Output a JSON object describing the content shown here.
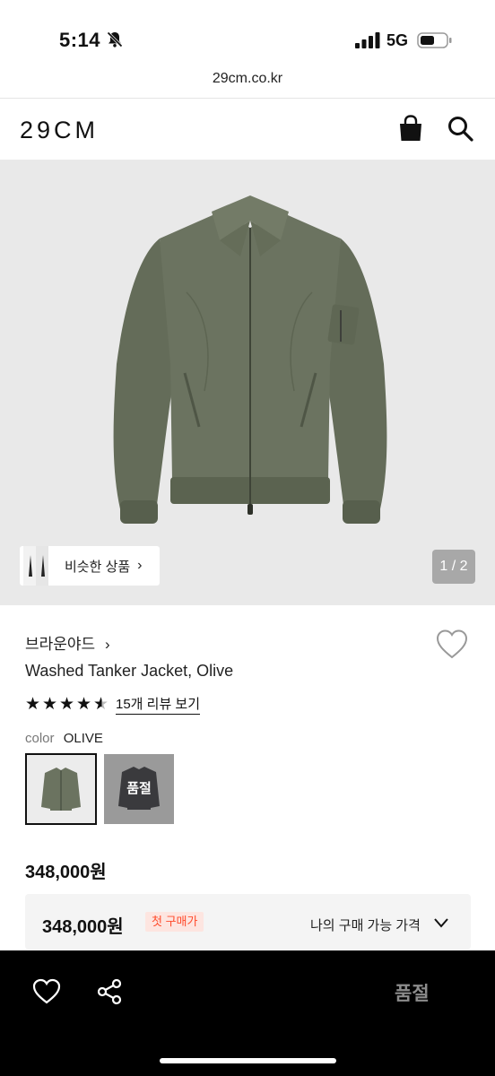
{
  "status_bar": {
    "time": "5:14",
    "network": "5G",
    "icons": [
      "mute-bell-icon",
      "signal-icon",
      "battery-icon"
    ]
  },
  "browser": {
    "url": "29cm.co.kr"
  },
  "header": {
    "logo": "29CM",
    "icons": [
      "shopping-bag-icon",
      "search-icon"
    ]
  },
  "gallery": {
    "similar_label": "비슷한 상품",
    "page_indicator": "1 / 2"
  },
  "product": {
    "brand": "브라운야드",
    "name": "Washed Tanker Jacket, Olive",
    "rating_stars": 4.5,
    "review_link": "15개 리뷰 보기",
    "color_label": "color",
    "color_value": "OLIVE",
    "swatches": [
      {
        "name": "olive",
        "selected": true
      },
      {
        "name": "black",
        "status": "품절"
      }
    ],
    "price": "348,000원"
  },
  "price_box": {
    "price": "348,000원",
    "badge": "첫 구매가",
    "my_price_label": "나의 구매 가능 가격"
  },
  "bottom_bar": {
    "buy_label": "품절",
    "icons": [
      "heart-icon",
      "share-icon"
    ]
  },
  "colors": {
    "accent_badge_text": "#ff4b2b",
    "accent_badge_bg": "#fde5e0",
    "bottom_bar_bg": "#000000",
    "jacket_olive": "#6b7360"
  }
}
